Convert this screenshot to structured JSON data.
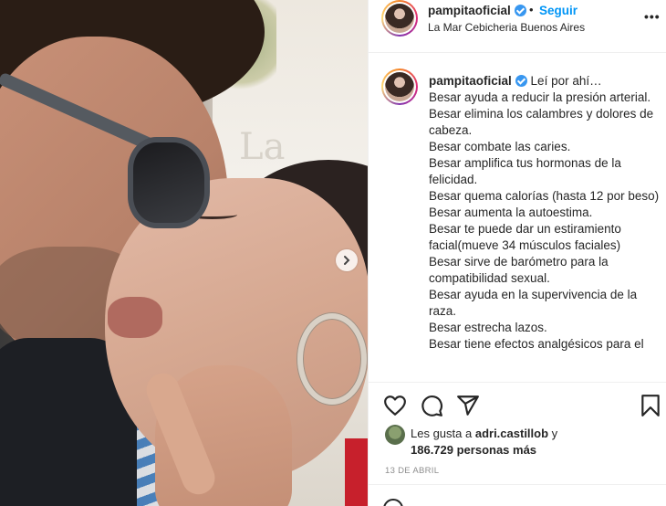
{
  "header": {
    "username": "pampitaoficial",
    "separator": "•",
    "follow_label": "Seguir",
    "location": "La Mar Cebicheria Buenos Aires",
    "more_label": "•••"
  },
  "caption": {
    "username": "pampitaoficial",
    "lines": [
      "Leí por ahí…",
      "Besar ayuda a reducir la presión arterial.",
      "Besar elimina los calambres y dolores de cabeza.",
      "Besar combate las caries.",
      "Besar amplifica tus hormonas de la felicidad.",
      "Besar quema calorías (hasta 12 por beso)",
      "Besar aumenta la autoestima.",
      "Besar te puede dar un estiramiento facial(mueve 34 músculos faciales)",
      "Besar sirve de barómetro para la compatibilidad sexual.",
      "Besar ayuda en la supervivencia de la raza.",
      "Besar estrecha lazos.",
      "Besar tiene efectos analgésicos para el"
    ]
  },
  "likes": {
    "prefix": "Les gusta a",
    "user": "adri.castillob",
    "conj": "y",
    "count_text": "186.729 personas más"
  },
  "date": "13 DE ABRIL",
  "photo_text": "La",
  "icons": {
    "like": "heart-icon",
    "comment": "comment-icon",
    "share": "share-icon",
    "save": "bookmark-icon",
    "next": "chevron-right-icon",
    "verified": "verified-badge-icon",
    "emoji": "emoji-icon"
  },
  "colors": {
    "link_blue": "#0095f6",
    "verified_blue": "#3897f0",
    "text": "#262626",
    "muted": "#8e8e8e"
  }
}
